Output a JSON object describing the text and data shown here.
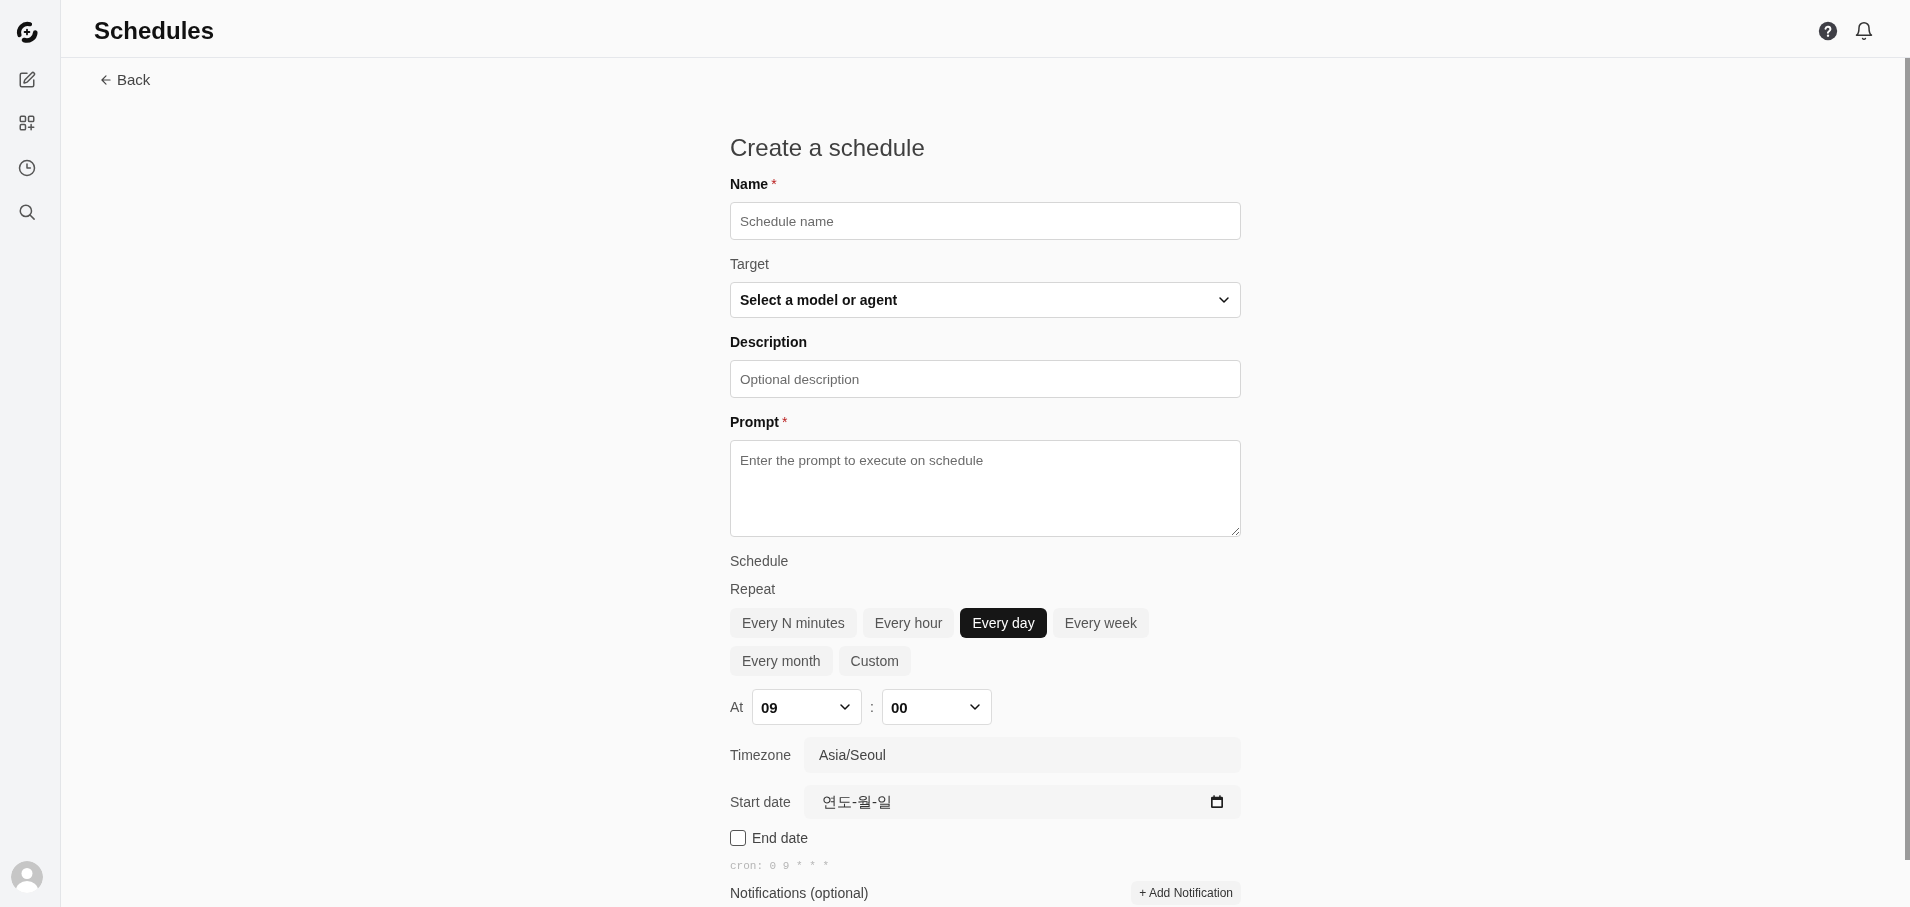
{
  "header": {
    "title": "Schedules"
  },
  "back_link": {
    "label": "Back"
  },
  "form": {
    "title": "Create a schedule",
    "fields": [
      {
        "kind": "text",
        "label": "Name",
        "required_mark": "*",
        "placeholder": "Schedule name"
      },
      {
        "kind": "select",
        "label": "Target",
        "value": "Select a model or agent"
      },
      {
        "kind": "text",
        "label": "Description",
        "placeholder": "Optional description"
      },
      {
        "kind": "textarea",
        "label": "Prompt",
        "required_mark": "*",
        "placeholder": "Enter the prompt to execute on schedule"
      }
    ],
    "schedule": {
      "heading": "Schedule",
      "repeat_label": "Repeat",
      "repeat_options": [
        {
          "label": "Every N minutes",
          "selected": false
        },
        {
          "label": "Every hour",
          "selected": false
        },
        {
          "label": "Every day",
          "selected": true
        },
        {
          "label": "Every week",
          "selected": false
        },
        {
          "label": "Every month",
          "selected": false
        },
        {
          "label": "Custom",
          "selected": false
        }
      ],
      "time": {
        "label": "At",
        "hour": "09",
        "separator": ":",
        "minute": "00"
      },
      "timezone": {
        "label": "Timezone",
        "value": "Asia/Seoul"
      },
      "start_date": {
        "label": "Start date",
        "placeholder": "연도-월-일"
      },
      "end_date": {
        "label": "End date",
        "checked": false
      },
      "cron": "cron: 0 9 * * *"
    },
    "notifications": {
      "label": "Notifications (optional)",
      "add_button": "+ Add Notification"
    }
  }
}
